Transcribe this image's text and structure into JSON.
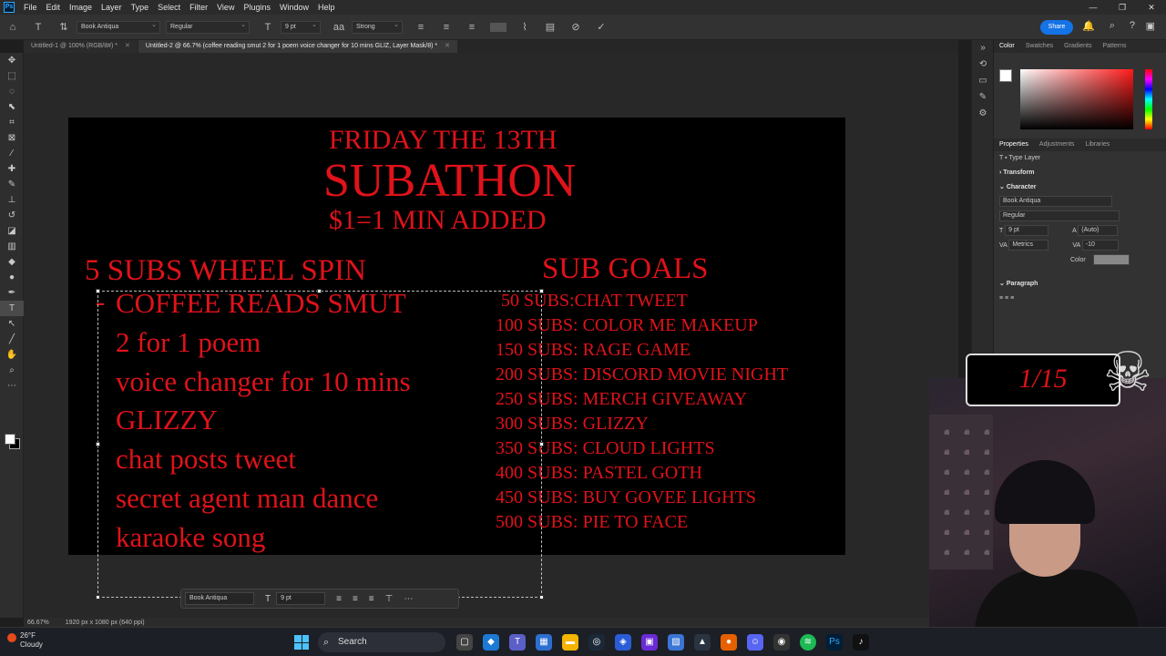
{
  "menubar": {
    "items": [
      "File",
      "Edit",
      "Image",
      "Layer",
      "Type",
      "Select",
      "Filter",
      "View",
      "Plugins",
      "Window",
      "Help"
    ],
    "logo": "Ps"
  },
  "options": {
    "font_family": "Book Antiqua",
    "font_style": "Regular",
    "font_size": "9 pt",
    "anti_alias": "Strong",
    "share_label": "Share"
  },
  "tabs": [
    {
      "label": "Untitled-1 @ 100% (RGB/8#) *"
    },
    {
      "label": "Untitled-2 @ 66.7% (coffee reading smut 2 for 1 poem voice changer for 10 mins GLIZ, Layer Mask/8) *"
    }
  ],
  "canvas": {
    "title_line1": "FRIDAY THE 13TH",
    "title_line2": "SUBATHON",
    "title_line3": "$1=1 MIN ADDED",
    "wheel_heading": "5 SUBS WHEEL SPIN",
    "cursor_dash": "-",
    "wheel_items": [
      "COFFEE READS SMUT",
      "2 for 1 poem",
      "voice changer for 10 mins",
      "GLIZZY",
      "chat posts tweet",
      "secret agent man dance",
      "karaoke song"
    ],
    "goals_heading": "SUB GOALS",
    "goals": [
      "50 SUBS:CHAT TWEET",
      "100 SUBS: COLOR ME MAKEUP",
      "150 SUBS: RAGE GAME",
      "200 SUBS: DISCORD MOVIE NIGHT",
      "250 SUBS: MERCH GIVEAWAY",
      "300 SUBS: GLIZZY",
      "350 SUBS: CLOUD LIGHTS",
      "400 SUBS: PASTEL GOTH",
      "450 SUBS: BUY GOVEE LIGHTS",
      "500 SUBS: PIE TO FACE"
    ],
    "text_color": "#e0121a"
  },
  "context_bar": {
    "font_family": "Book Antiqua",
    "font_size": "9 pt"
  },
  "status": {
    "zoom": "66.67%",
    "doc_info": "1920 px x 1080 px (640 ppi)"
  },
  "panels": {
    "color_tabs": [
      "Color",
      "Swatches",
      "Gradients",
      "Patterns"
    ],
    "props_tabs": [
      "Properties",
      "Adjustments",
      "Libraries"
    ],
    "type_layer": "Type Layer",
    "transform": "Transform",
    "character": "Character",
    "char_font": "Book Antiqua",
    "char_style": "Regular",
    "char_size": "9 pt",
    "char_leading": "(Auto)",
    "char_kerning": "Metrics",
    "char_tracking": "-10",
    "color_label": "Color",
    "paragraph": "Paragraph"
  },
  "overlay": {
    "counter": "1/15"
  },
  "taskbar": {
    "temperature": "26°F",
    "condition": "Cloudy",
    "search_label": "Search"
  }
}
